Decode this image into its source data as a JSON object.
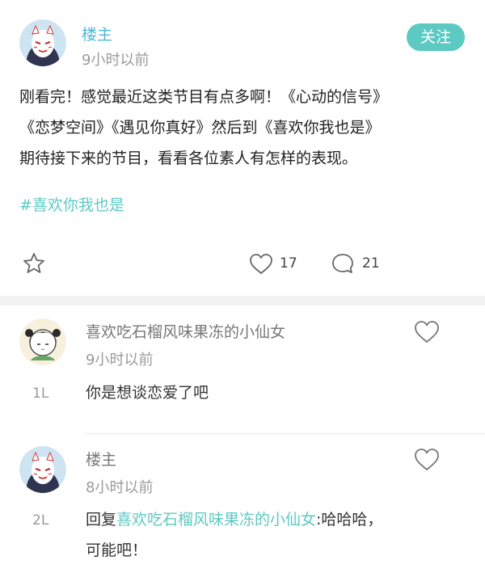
{
  "post": {
    "author": "楼主",
    "time": "9小时以前",
    "follow_label": "关注",
    "body_lines": [
      "刚看完！感觉最近这类节目有点多啊！《心动的信号》",
      "《恋梦空间》《遇见你真好》然后到《喜欢你我也是》",
      "期待接下来的节目，看看各位素人有怎样的表现。"
    ],
    "hashtag": "#喜欢你我也是",
    "likes": "17",
    "comments": "21",
    "icons": {
      "star": "star-icon",
      "like": "heart-icon",
      "comment": "comment-bubble-icon"
    }
  },
  "comments": [
    {
      "floor": "1L",
      "author": "喜欢吃石榴风味果冻的小仙女",
      "time": "9小时以前",
      "text": "你是想谈恋爱了吧"
    },
    {
      "floor": "2L",
      "author": "楼主",
      "time": "8小时以前",
      "reply_prefix": "回复",
      "reply_to": "喜欢吃石榴风味果冻的小仙女",
      "reply_text_1": ":哈哈哈，",
      "reply_text_2": "可能吧！"
    }
  ],
  "colors": {
    "accent": "#5dc9c3",
    "username": "#4fb8d6",
    "separator": "#f2f2f2"
  }
}
